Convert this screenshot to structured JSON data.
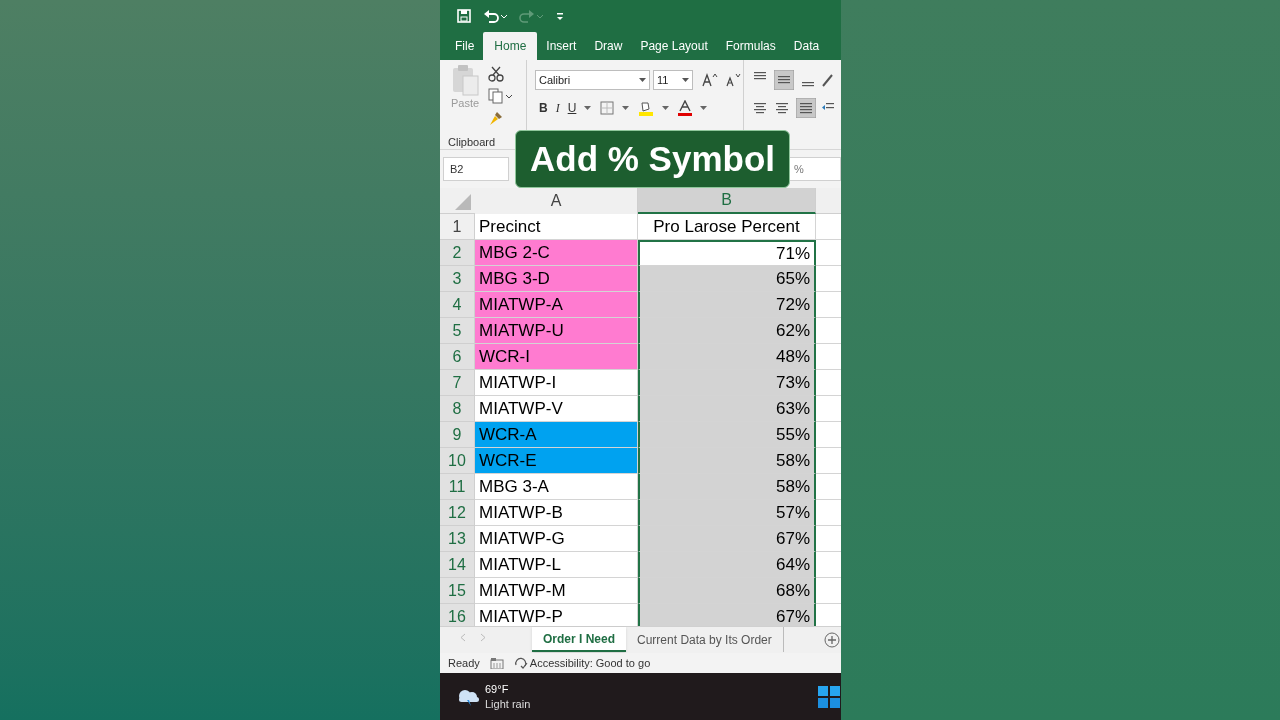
{
  "ribbon_tabs": [
    {
      "label": "File",
      "selected": false
    },
    {
      "label": "Home",
      "selected": true
    },
    {
      "label": "Insert",
      "selected": false
    },
    {
      "label": "Draw",
      "selected": false
    },
    {
      "label": "Page Layout",
      "selected": false
    },
    {
      "label": "Formulas",
      "selected": false
    },
    {
      "label": "Data",
      "selected": false
    }
  ],
  "ribbon": {
    "paste_label": "Paste",
    "clipboard_group": "Clipboard",
    "font_name": "Calibri",
    "font_size": "11",
    "bold": "B",
    "italic": "I",
    "underline": "U"
  },
  "name_box": "B2",
  "formula_value": "%",
  "caption": "Add % Symbol",
  "columns": [
    {
      "label": "A",
      "selected": false
    },
    {
      "label": "B",
      "selected": true
    }
  ],
  "rows": [
    {
      "number": "1",
      "a": "Precinct",
      "b": "Pro Larose Percent",
      "kind": "header",
      "selected": false
    },
    {
      "number": "2",
      "a": "MBG 2-C",
      "b": "71%",
      "color": "#ff7bd0",
      "kind": "data",
      "selected": true,
      "active": true
    },
    {
      "number": "3",
      "a": "MBG 3-D",
      "b": "65%",
      "color": "#ff7bd0",
      "kind": "data",
      "selected": true,
      "active": false
    },
    {
      "number": "4",
      "a": "MIATWP-A",
      "b": "72%",
      "color": "#ff7bd0",
      "kind": "data",
      "selected": true,
      "active": false
    },
    {
      "number": "5",
      "a": "MIATWP-U",
      "b": "62%",
      "color": "#ff7bd0",
      "kind": "data",
      "selected": true,
      "active": false
    },
    {
      "number": "6",
      "a": "WCR-I",
      "b": "48%",
      "color": "#ff7bd0",
      "kind": "data",
      "selected": true,
      "active": false
    },
    {
      "number": "7",
      "a": "MIATWP-I",
      "b": "73%",
      "kind": "data",
      "selected": true,
      "active": false
    },
    {
      "number": "8",
      "a": "MIATWP-V",
      "b": "63%",
      "kind": "data",
      "selected": true,
      "active": false
    },
    {
      "number": "9",
      "a": "WCR-A",
      "b": "55%",
      "color": "#00a2f0",
      "kind": "data",
      "selected": true,
      "active": false
    },
    {
      "number": "10",
      "a": "WCR-E",
      "b": "58%",
      "color": "#00a2f0",
      "kind": "data",
      "selected": true,
      "active": false
    },
    {
      "number": "11",
      "a": "MBG 3-A",
      "b": "58%",
      "kind": "data",
      "selected": true,
      "active": false
    },
    {
      "number": "12",
      "a": "MIATWP-B",
      "b": "57%",
      "kind": "data",
      "selected": true,
      "active": false
    },
    {
      "number": "13",
      "a": "MIATWP-G",
      "b": "67%",
      "kind": "data",
      "selected": true,
      "active": false
    },
    {
      "number": "14",
      "a": "MIATWP-L",
      "b": "64%",
      "kind": "data",
      "selected": true,
      "active": false
    },
    {
      "number": "15",
      "a": "MIATWP-M",
      "b": "68%",
      "kind": "data",
      "selected": true,
      "active": false
    },
    {
      "number": "16",
      "a": "MIATWP-P",
      "b": "67%",
      "kind": "data",
      "selected": true,
      "active": false
    }
  ],
  "sheet_tabs": [
    {
      "label": "Order I Need",
      "selected": true
    },
    {
      "label": "Current Data by Its Order",
      "selected": false
    }
  ],
  "status_bar": {
    "ready": "Ready",
    "accessibility": "Accessibility: Good to go"
  },
  "taskbar": {
    "temperature": "69°F",
    "weather": "Light rain"
  }
}
